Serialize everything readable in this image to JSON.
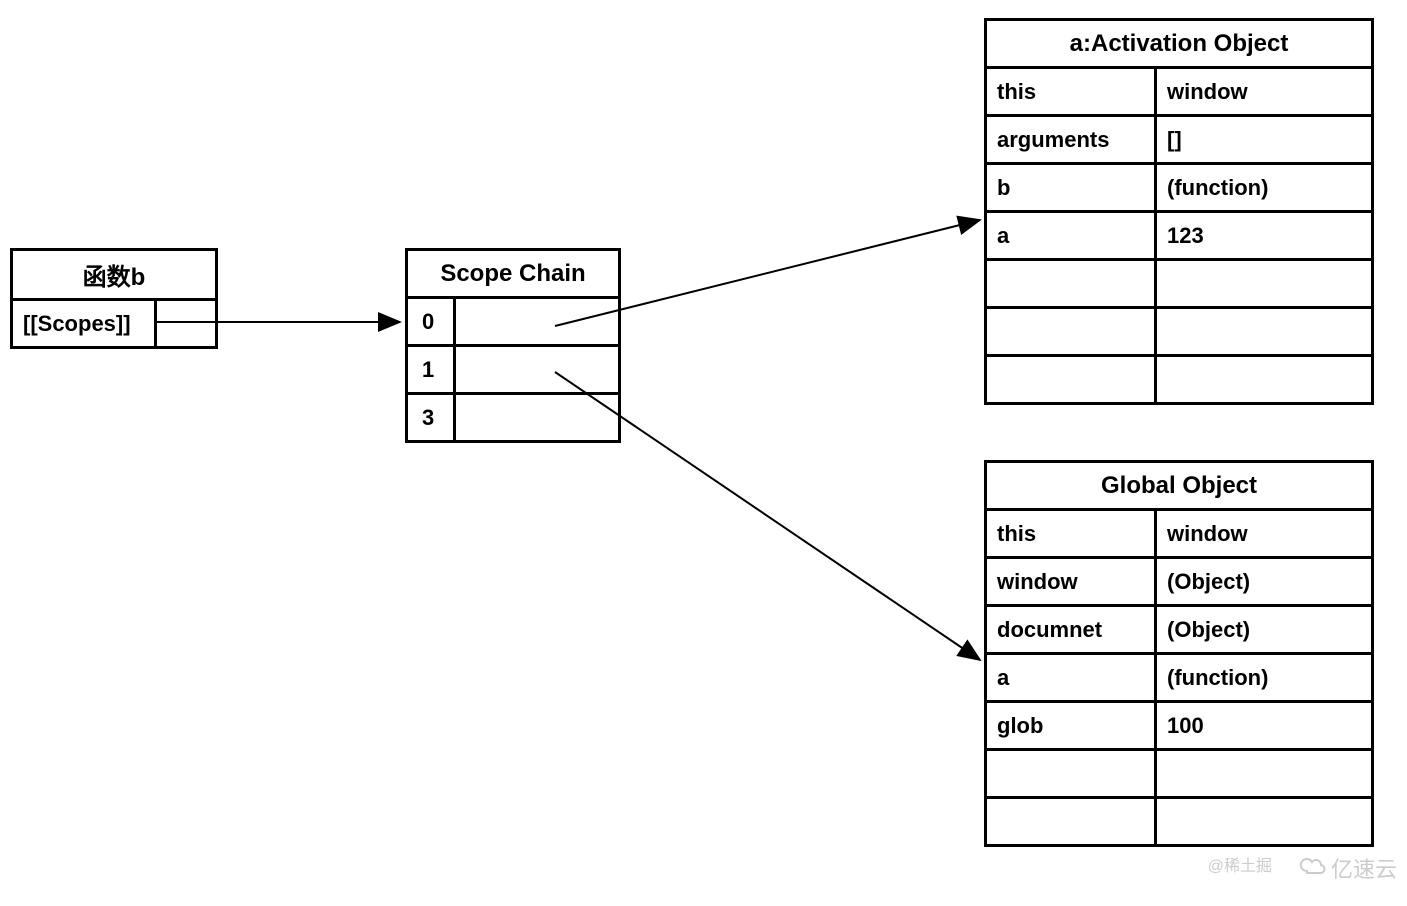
{
  "func_b": {
    "title": "函数b",
    "prop_label": "[[Scopes]]"
  },
  "scope_chain": {
    "title": "Scope Chain",
    "rows": [
      "0",
      "1",
      "3"
    ]
  },
  "activation_object": {
    "title": "a:Activation Object",
    "rows": [
      {
        "k": "this",
        "v": "window"
      },
      {
        "k": "arguments",
        "v": "[]"
      },
      {
        "k": "b",
        "v": "(function)"
      },
      {
        "k": "a",
        "v": "123"
      },
      {
        "k": "",
        "v": ""
      },
      {
        "k": "",
        "v": ""
      },
      {
        "k": "",
        "v": ""
      }
    ]
  },
  "global_object": {
    "title": "Global Object",
    "rows": [
      {
        "k": "this",
        "v": "window"
      },
      {
        "k": "window",
        "v": "(Object)"
      },
      {
        "k": "documnet",
        "v": "(Object)"
      },
      {
        "k": "a",
        "v": "(function)"
      },
      {
        "k": "glob",
        "v": "100"
      },
      {
        "k": "",
        "v": ""
      },
      {
        "k": "",
        "v": ""
      }
    ]
  },
  "watermark": {
    "left": "@稀土掘",
    "right": "亿速云"
  },
  "chart_data": {
    "type": "table",
    "description": "Scope chain diagram showing function b's [[Scopes]] pointing to a Scope Chain with entries 0,1,3; entry 0 points to a:Activation Object; entry 1 points to Global Object.",
    "edges": [
      {
        "from": "func_b.[[Scopes]]",
        "to": "scope_chain"
      },
      {
        "from": "scope_chain[0]",
        "to": "activation_object"
      },
      {
        "from": "scope_chain[1]",
        "to": "global_object"
      }
    ],
    "activation_object": {
      "this": "window",
      "arguments": "[]",
      "b": "(function)",
      "a": 123
    },
    "global_object": {
      "this": "window",
      "window": "(Object)",
      "documnet": "(Object)",
      "a": "(function)",
      "glob": 100
    }
  }
}
